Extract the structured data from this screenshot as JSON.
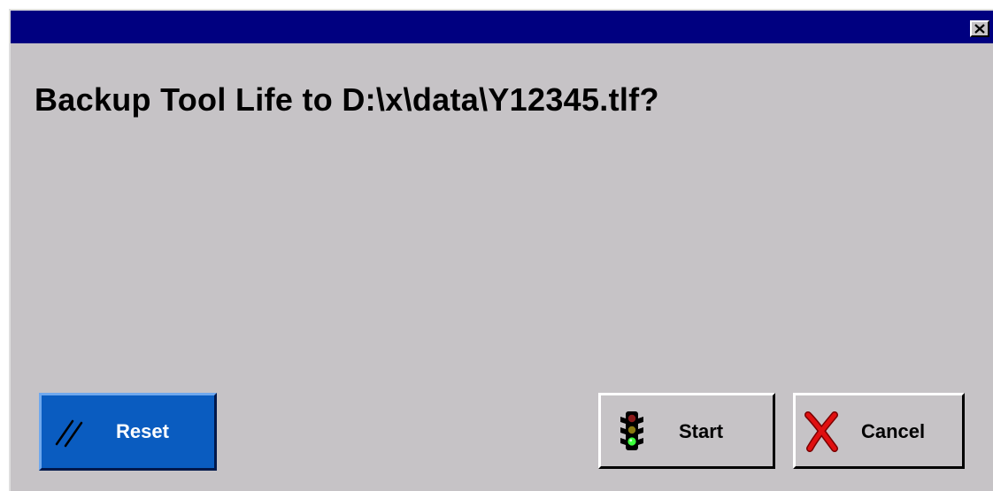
{
  "dialog": {
    "message": "Backup Tool Life to D:\\x\\data\\Y12345.tlf?",
    "title": ""
  },
  "buttons": {
    "reset": {
      "label": "Reset",
      "icon": "slash-icon",
      "color": "#0a5cc0"
    },
    "start": {
      "label": "Start",
      "icon": "traffic-light-icon"
    },
    "cancel": {
      "label": "Cancel",
      "icon": "red-x-icon"
    }
  },
  "colors": {
    "titlebar": "#000080",
    "face": "#c6c3c6",
    "reset_face": "#0a5cc0"
  }
}
